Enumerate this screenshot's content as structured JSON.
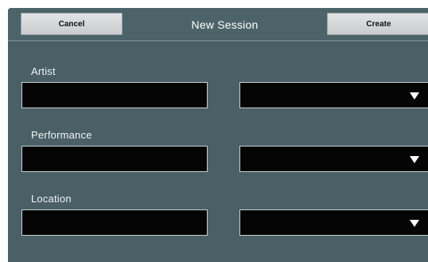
{
  "header": {
    "cancel_label": "Cancel",
    "title": "New Session",
    "create_label": "Create"
  },
  "form": {
    "artist": {
      "label": "Artist",
      "value": "",
      "dropdown_value": ""
    },
    "performance": {
      "label": "Performance",
      "value": "",
      "dropdown_value": ""
    },
    "location": {
      "label": "Location",
      "value": "",
      "dropdown_value": ""
    }
  },
  "colors": {
    "background": "#4a6066",
    "field_background": "#050505",
    "button_background": "#d6d8da",
    "text": "#ffffff"
  },
  "icons": {
    "dropdown": "chevron-down-icon"
  }
}
